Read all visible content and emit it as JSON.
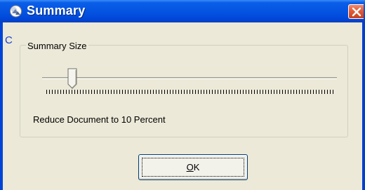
{
  "window": {
    "title": "Summary",
    "close_label": "Close"
  },
  "stray_char": "C",
  "group": {
    "label": "Summary Size"
  },
  "slider": {
    "value_percent": 10,
    "min": 0,
    "max": 100
  },
  "status_text": "Reduce Document to 10 Percent",
  "ok_button": {
    "label": "OK",
    "mnemonic": "O",
    "rest": "K"
  },
  "colors": {
    "titlebar": "#0453e0",
    "close": "#e35b36",
    "face": "#ece9d8"
  },
  "icons": [
    "app-icon",
    "close-icon",
    "slider-thumb"
  ]
}
